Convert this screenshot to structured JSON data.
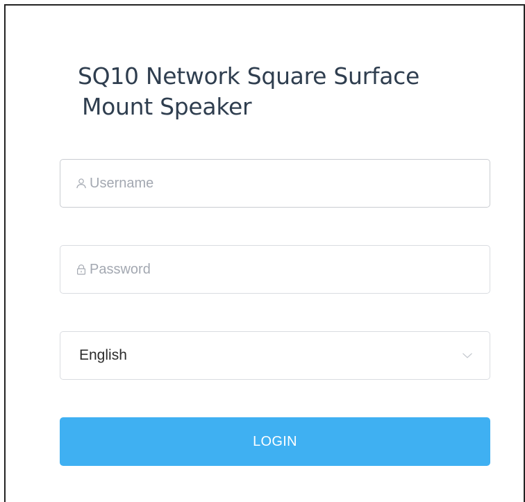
{
  "login": {
    "title_line1": "SQ10 Network Square Surface",
    "title_line2": "Mount Speaker",
    "username": {
      "placeholder": "Username",
      "value": "",
      "icon": "user-icon"
    },
    "password": {
      "placeholder": "Password",
      "value": "",
      "icon": "lock-icon"
    },
    "language": {
      "selected": "English",
      "icon": "chevron-down-icon"
    },
    "login_label": "LOGIN"
  },
  "colors": {
    "accent": "#3fb0f2",
    "title_text": "#2f3e4f",
    "placeholder": "#a3a8b1",
    "border": "#d9dce1"
  }
}
